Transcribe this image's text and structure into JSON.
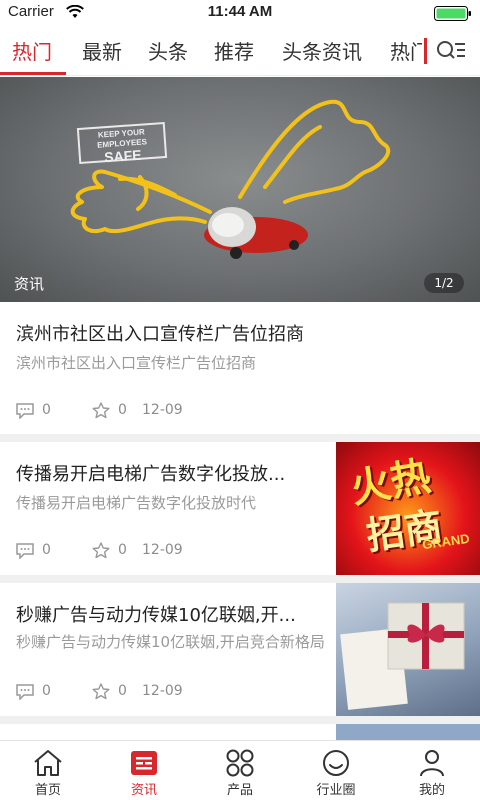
{
  "status_bar": {
    "carrier": "Carrier",
    "time": "11:44 AM"
  },
  "tabs": [
    {
      "label": "热门",
      "active": true
    },
    {
      "label": "最新"
    },
    {
      "label": "头条"
    },
    {
      "label": "推荐"
    },
    {
      "label": "头条资讯"
    },
    {
      "label": "热门"
    }
  ],
  "banner": {
    "sign_line1": "KEEP YOUR",
    "sign_line2": "EMPLOYEES",
    "sign_line3": "SAFE",
    "caption": "资讯",
    "counter": "1/2"
  },
  "news": [
    {
      "title": "滨州市社区出入口宣传栏广告位招商",
      "desc": "滨州市社区出入口宣传栏广告位招商",
      "comments": "0",
      "stars": "0",
      "date": "12-09"
    },
    {
      "title": "传播易开启电梯广告数字化投放...",
      "desc": "传播易开启电梯广告数字化投放时代",
      "comments": "0",
      "stars": "0",
      "date": "12-09",
      "thumb_text_1": "火热",
      "thumb_text_2": "招商",
      "thumb_text_3": "GRAND"
    },
    {
      "title": "秒赚广告与动力传媒10亿联姻,开...",
      "desc": "秒赚广告与动力传媒10亿联姻,开启竞合新格局",
      "comments": "0",
      "stars": "0",
      "date": "12-09"
    }
  ],
  "bottom_nav": [
    {
      "label": "首页",
      "icon": "home-icon"
    },
    {
      "label": "资讯",
      "icon": "news-icon",
      "active": true
    },
    {
      "label": "产品",
      "icon": "products-icon"
    },
    {
      "label": "行业圈",
      "icon": "industry-circle-icon"
    },
    {
      "label": "我的",
      "icon": "profile-icon"
    }
  ],
  "colors": {
    "accent": "#d9272e",
    "text": "#222222",
    "muted": "#9a9a9a"
  }
}
